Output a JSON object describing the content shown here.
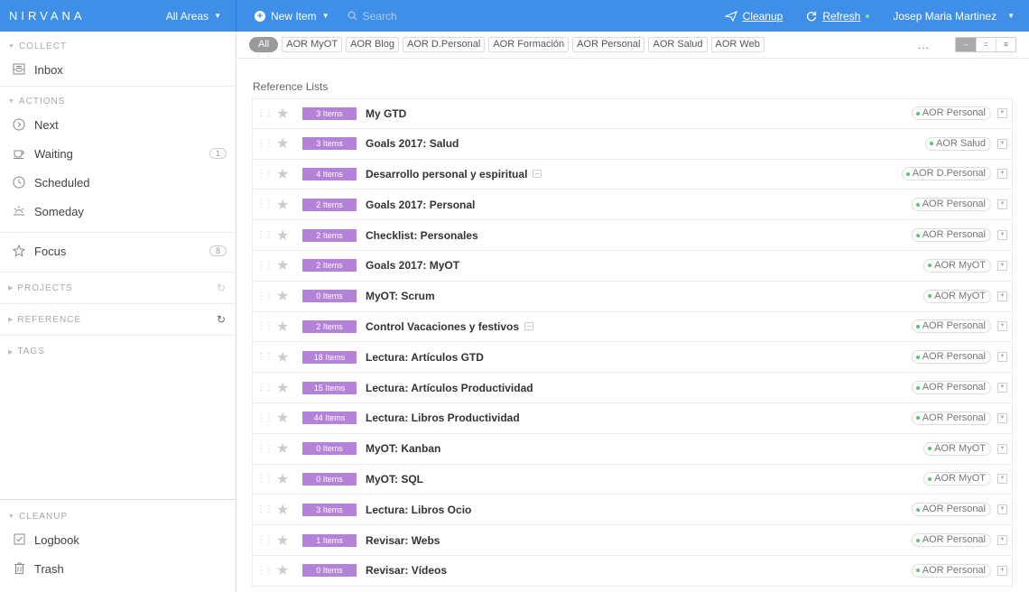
{
  "topbar": {
    "logo": "NIRVANA",
    "areas_label": "All Areas",
    "new_item_label": "New Item",
    "search_placeholder": "Search",
    "cleanup_label": "Cleanup",
    "refresh_label": "Refresh",
    "user_name": "Josep Maria Martinez"
  },
  "sidebar": {
    "collect_title": "COLLECT",
    "inbox_label": "Inbox",
    "actions_title": "ACTIONS",
    "next_label": "Next",
    "waiting_label": "Waiting",
    "waiting_count": "1",
    "scheduled_label": "Scheduled",
    "someday_label": "Someday",
    "focus_label": "Focus",
    "focus_count": "8",
    "projects_title": "PROJECTS",
    "reference_title": "REFERENCE",
    "tags_title": "TAGS",
    "cleanup_title": "CLEANUP",
    "logbook_label": "Logbook",
    "trash_label": "Trash"
  },
  "filters": {
    "chips": [
      "All",
      "AOR MyOT",
      "AOR Blog",
      "AOR D.Personal",
      "AOR Formación",
      "AOR Personal",
      "AOR Salud",
      "AOR Web"
    ],
    "more": "..."
  },
  "main": {
    "title": "Reference Lists",
    "rows": [
      {
        "items": "3 Items",
        "name": "My GTD",
        "note": false,
        "tag": "AOR Personal"
      },
      {
        "items": "3 Items",
        "name": "Goals 2017: Salud",
        "note": false,
        "tag": "AOR Salud"
      },
      {
        "items": "4 Items",
        "name": "Desarrollo personal y espiritual",
        "note": true,
        "tag": "AOR D.Personal"
      },
      {
        "items": "2 Items",
        "name": "Goals 2017: Personal",
        "note": false,
        "tag": "AOR Personal"
      },
      {
        "items": "2 Items",
        "name": "Checklist: Personales",
        "note": false,
        "tag": "AOR Personal"
      },
      {
        "items": "2 Items",
        "name": "Goals 2017: MyOT",
        "note": false,
        "tag": "AOR MyOT"
      },
      {
        "items": "0 Items",
        "name": "MyOT: Scrum",
        "note": false,
        "tag": "AOR MyOT"
      },
      {
        "items": "2 Items",
        "name": "Control Vacaciones y festivos",
        "note": true,
        "tag": "AOR Personal"
      },
      {
        "items": "18 Items",
        "name": "Lectura: Artículos GTD",
        "note": false,
        "tag": "AOR Personal"
      },
      {
        "items": "15 Items",
        "name": "Lectura: Artículos Productividad",
        "note": false,
        "tag": "AOR Personal"
      },
      {
        "items": "44 Items",
        "name": "Lectura: Libros Productividad",
        "note": false,
        "tag": "AOR Personal"
      },
      {
        "items": "0 Items",
        "name": "MyOT: Kanban",
        "note": false,
        "tag": "AOR MyOT"
      },
      {
        "items": "0 Items",
        "name": "MyOT: SQL",
        "note": false,
        "tag": "AOR MyOT"
      },
      {
        "items": "3 Items",
        "name": "Lectura: Libros Ocio",
        "note": false,
        "tag": "AOR Personal"
      },
      {
        "items": "1 Items",
        "name": "Revisar: Webs",
        "note": false,
        "tag": "AOR Personal"
      },
      {
        "items": "0 Items",
        "name": "Revisar: Vídeos",
        "note": false,
        "tag": "AOR Personal"
      }
    ]
  },
  "colors": {
    "topbar": "#3f8fe8",
    "badge": "#b482d8",
    "tag_dot": "#5cc46e"
  }
}
